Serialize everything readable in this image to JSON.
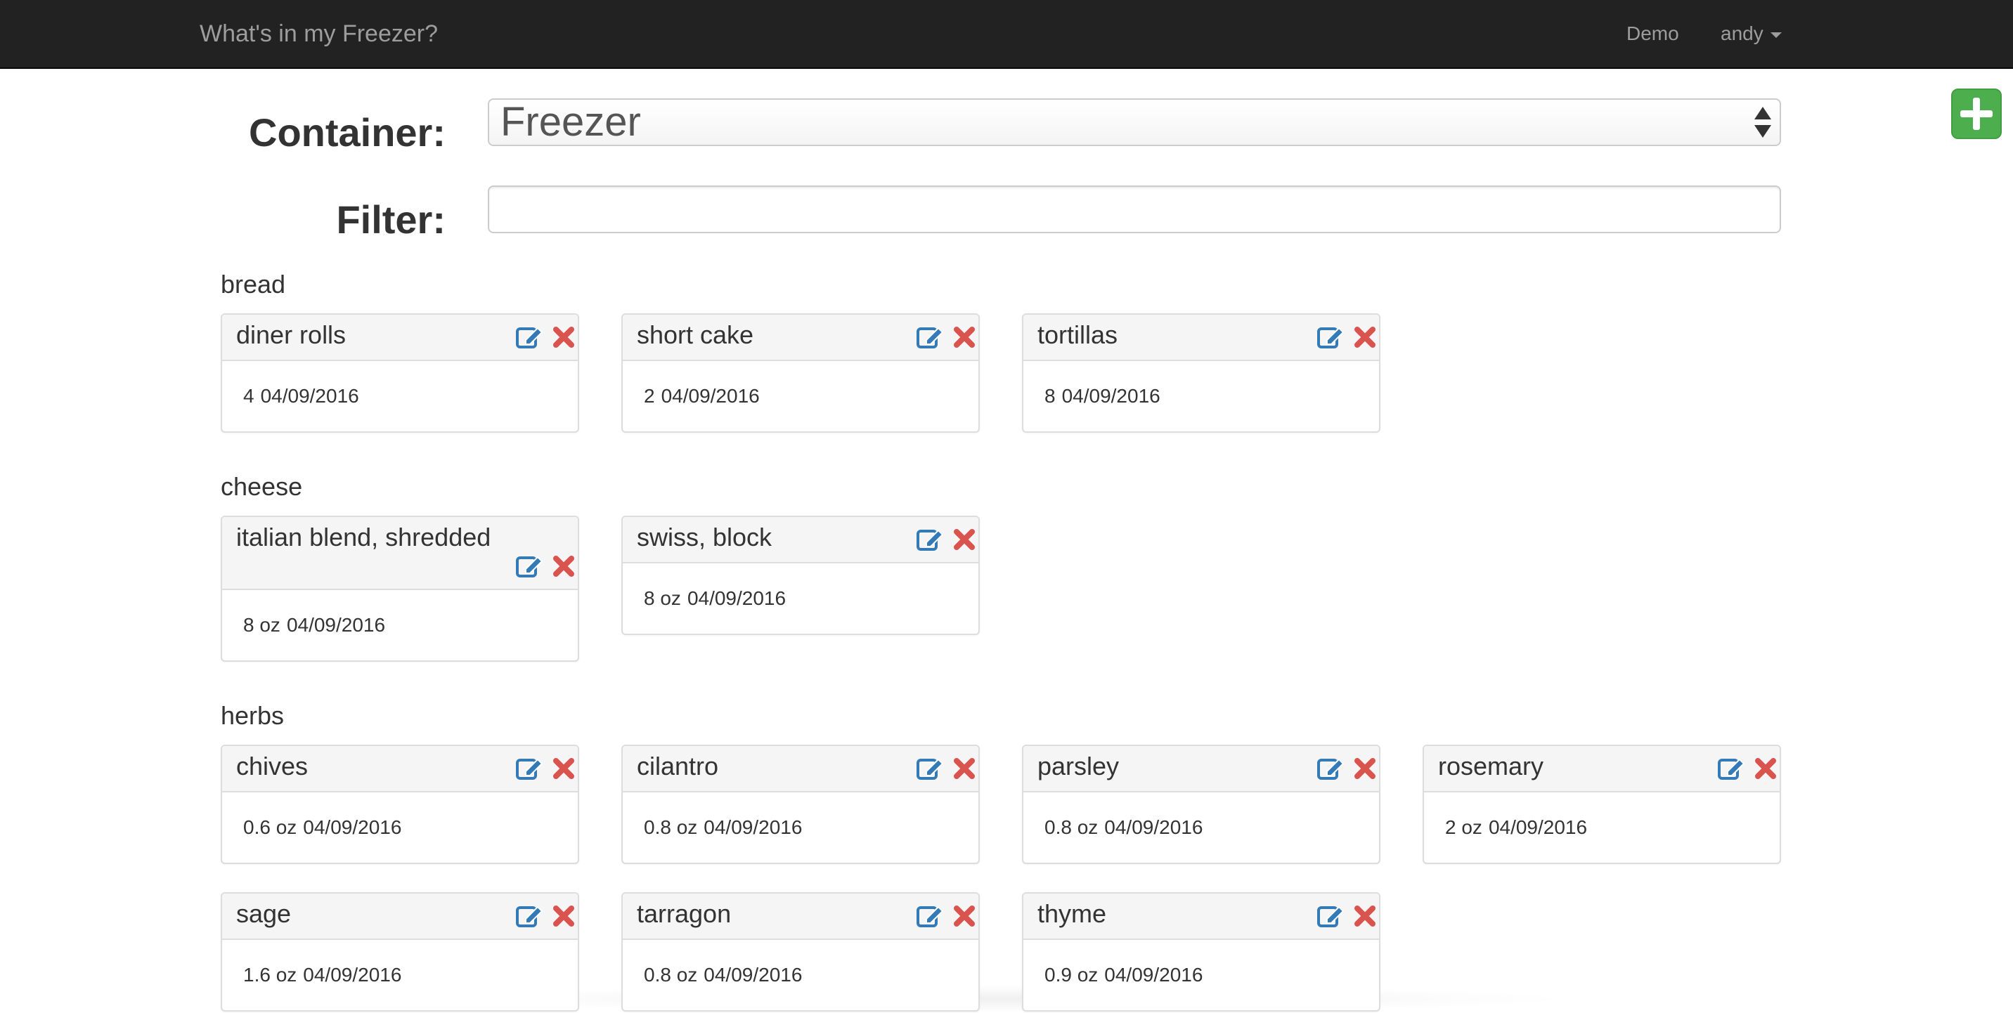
{
  "app": {
    "brand": "What's in my Freezer?",
    "nav_demo": "Demo",
    "nav_user": "andy",
    "add_icon": "plus-square-icon",
    "colors": {
      "navbar": "#222222",
      "add_button": "#4cae4c",
      "edit_icon": "#337ab7",
      "delete_icon": "#d9534f"
    }
  },
  "form": {
    "container_label": "Container:",
    "container_value": "Freezer",
    "filter_label": "Filter:",
    "filter_value": "",
    "filter_placeholder": ""
  },
  "categories": [
    {
      "name": "bread",
      "items": [
        {
          "name": "diner rolls",
          "quantity": "4",
          "date": "04/09/2016"
        },
        {
          "name": "short cake",
          "quantity": "2",
          "date": "04/09/2016"
        },
        {
          "name": "tortillas",
          "quantity": "8",
          "date": "04/09/2016"
        }
      ]
    },
    {
      "name": "cheese",
      "items": [
        {
          "name": "italian blend, shredded",
          "quantity": "8 oz",
          "date": "04/09/2016"
        },
        {
          "name": "swiss, block",
          "quantity": "8 oz",
          "date": "04/09/2016"
        }
      ]
    },
    {
      "name": "herbs",
      "items": [
        {
          "name": "chives",
          "quantity": "0.6 oz",
          "date": "04/09/2016"
        },
        {
          "name": "cilantro",
          "quantity": "0.8 oz",
          "date": "04/09/2016"
        },
        {
          "name": "parsley",
          "quantity": "0.8 oz",
          "date": "04/09/2016"
        },
        {
          "name": "rosemary",
          "quantity": "2 oz",
          "date": "04/09/2016"
        },
        {
          "name": "sage",
          "quantity": "1.6 oz",
          "date": "04/09/2016"
        },
        {
          "name": "tarragon",
          "quantity": "0.8 oz",
          "date": "04/09/2016"
        },
        {
          "name": "thyme",
          "quantity": "0.9 oz",
          "date": "04/09/2016"
        }
      ]
    }
  ]
}
